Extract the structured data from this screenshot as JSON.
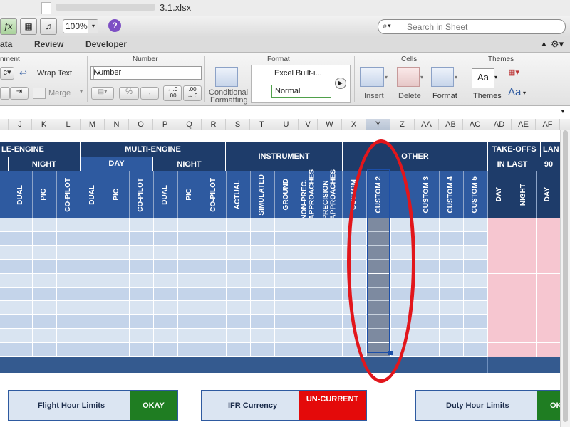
{
  "window": {
    "title": "3.1.xlsx"
  },
  "toolbar": {
    "fx_label": "fx",
    "zoom_value": "100%",
    "help_label": "?",
    "search_placeholder": "Search in Sheet",
    "search_icon": "magnifier-icon"
  },
  "ribbon_tabs": [
    "ata",
    "Review",
    "Developer"
  ],
  "ribbon": {
    "groups": {
      "alignment": "nment",
      "number": "Number",
      "format": "Format",
      "cells": "Cells",
      "themes": "Themes"
    },
    "wrap_text": "Wrap Text",
    "merge": "Merge",
    "align_dd": "c",
    "number_format": "Number",
    "percent": "%",
    "comma": ",",
    "dec_inc": "←.0 .00",
    "dec_dec": ".00 →.0",
    "conditional": "Conditional",
    "formatting": "Formatting",
    "style_builtin": "Excel Built-i...",
    "style_normal": "Normal",
    "insert": "Insert",
    "delete": "Delete",
    "format": "Format",
    "themes": "Themes",
    "aa_small": "Aa",
    "aa_big": "Aa"
  },
  "columns": [
    "J",
    "K",
    "L",
    "M",
    "N",
    "O",
    "P",
    "Q",
    "R",
    "S",
    "T",
    "U",
    "V",
    "W",
    "X",
    "Y",
    "Z",
    "AA",
    "AB",
    "AC",
    "AD",
    "AE",
    "AF"
  ],
  "selected_column": "Y",
  "sheet": {
    "groups": {
      "single_engine": "LE-ENGINE",
      "multi_engine": "MULTI-ENGINE",
      "instrument": "INSTRUMENT",
      "other": "OTHER",
      "takeoffs": "TAKE-OFFS",
      "landings": "LAN"
    },
    "sub": {
      "night_se": "NIGHT",
      "day_me": "DAY",
      "night_me": "NIGHT",
      "in_last": "IN LAST",
      "ninety": "90"
    },
    "col_labels": [
      "DUAL",
      "PIC",
      "CO-PILOT",
      "DUAL",
      "PIC",
      "CO-PILOT",
      "DUAL",
      "PIC",
      "CO-PILOT",
      "ACTUAL",
      "SIMULATED",
      "GROUND",
      "NON-PREC. APPROACHES",
      "PRECISION APPROACHES",
      "CUSTOM",
      "CUSTOM 2",
      "CUSTOM 3",
      "CUSTOM 4",
      "CUSTOM 5",
      "DAY",
      "NIGHT",
      "DAY"
    ]
  },
  "status": {
    "flight_hour_limits": {
      "label": "Flight Hour Limits",
      "value": "OKAY"
    },
    "ifr_currency": {
      "label": "IFR Currency",
      "value": "UN-CURRENT"
    },
    "duty_hour_limits": {
      "label": "Duty Hour Limits",
      "value": "OK"
    }
  },
  "colors": {
    "header_dark": "#1e3c6a",
    "header_mid": "#2e5aa0",
    "ok_green": "#1f7d22",
    "alert_red": "#e40a0a",
    "highlight_red": "#e2161c"
  }
}
